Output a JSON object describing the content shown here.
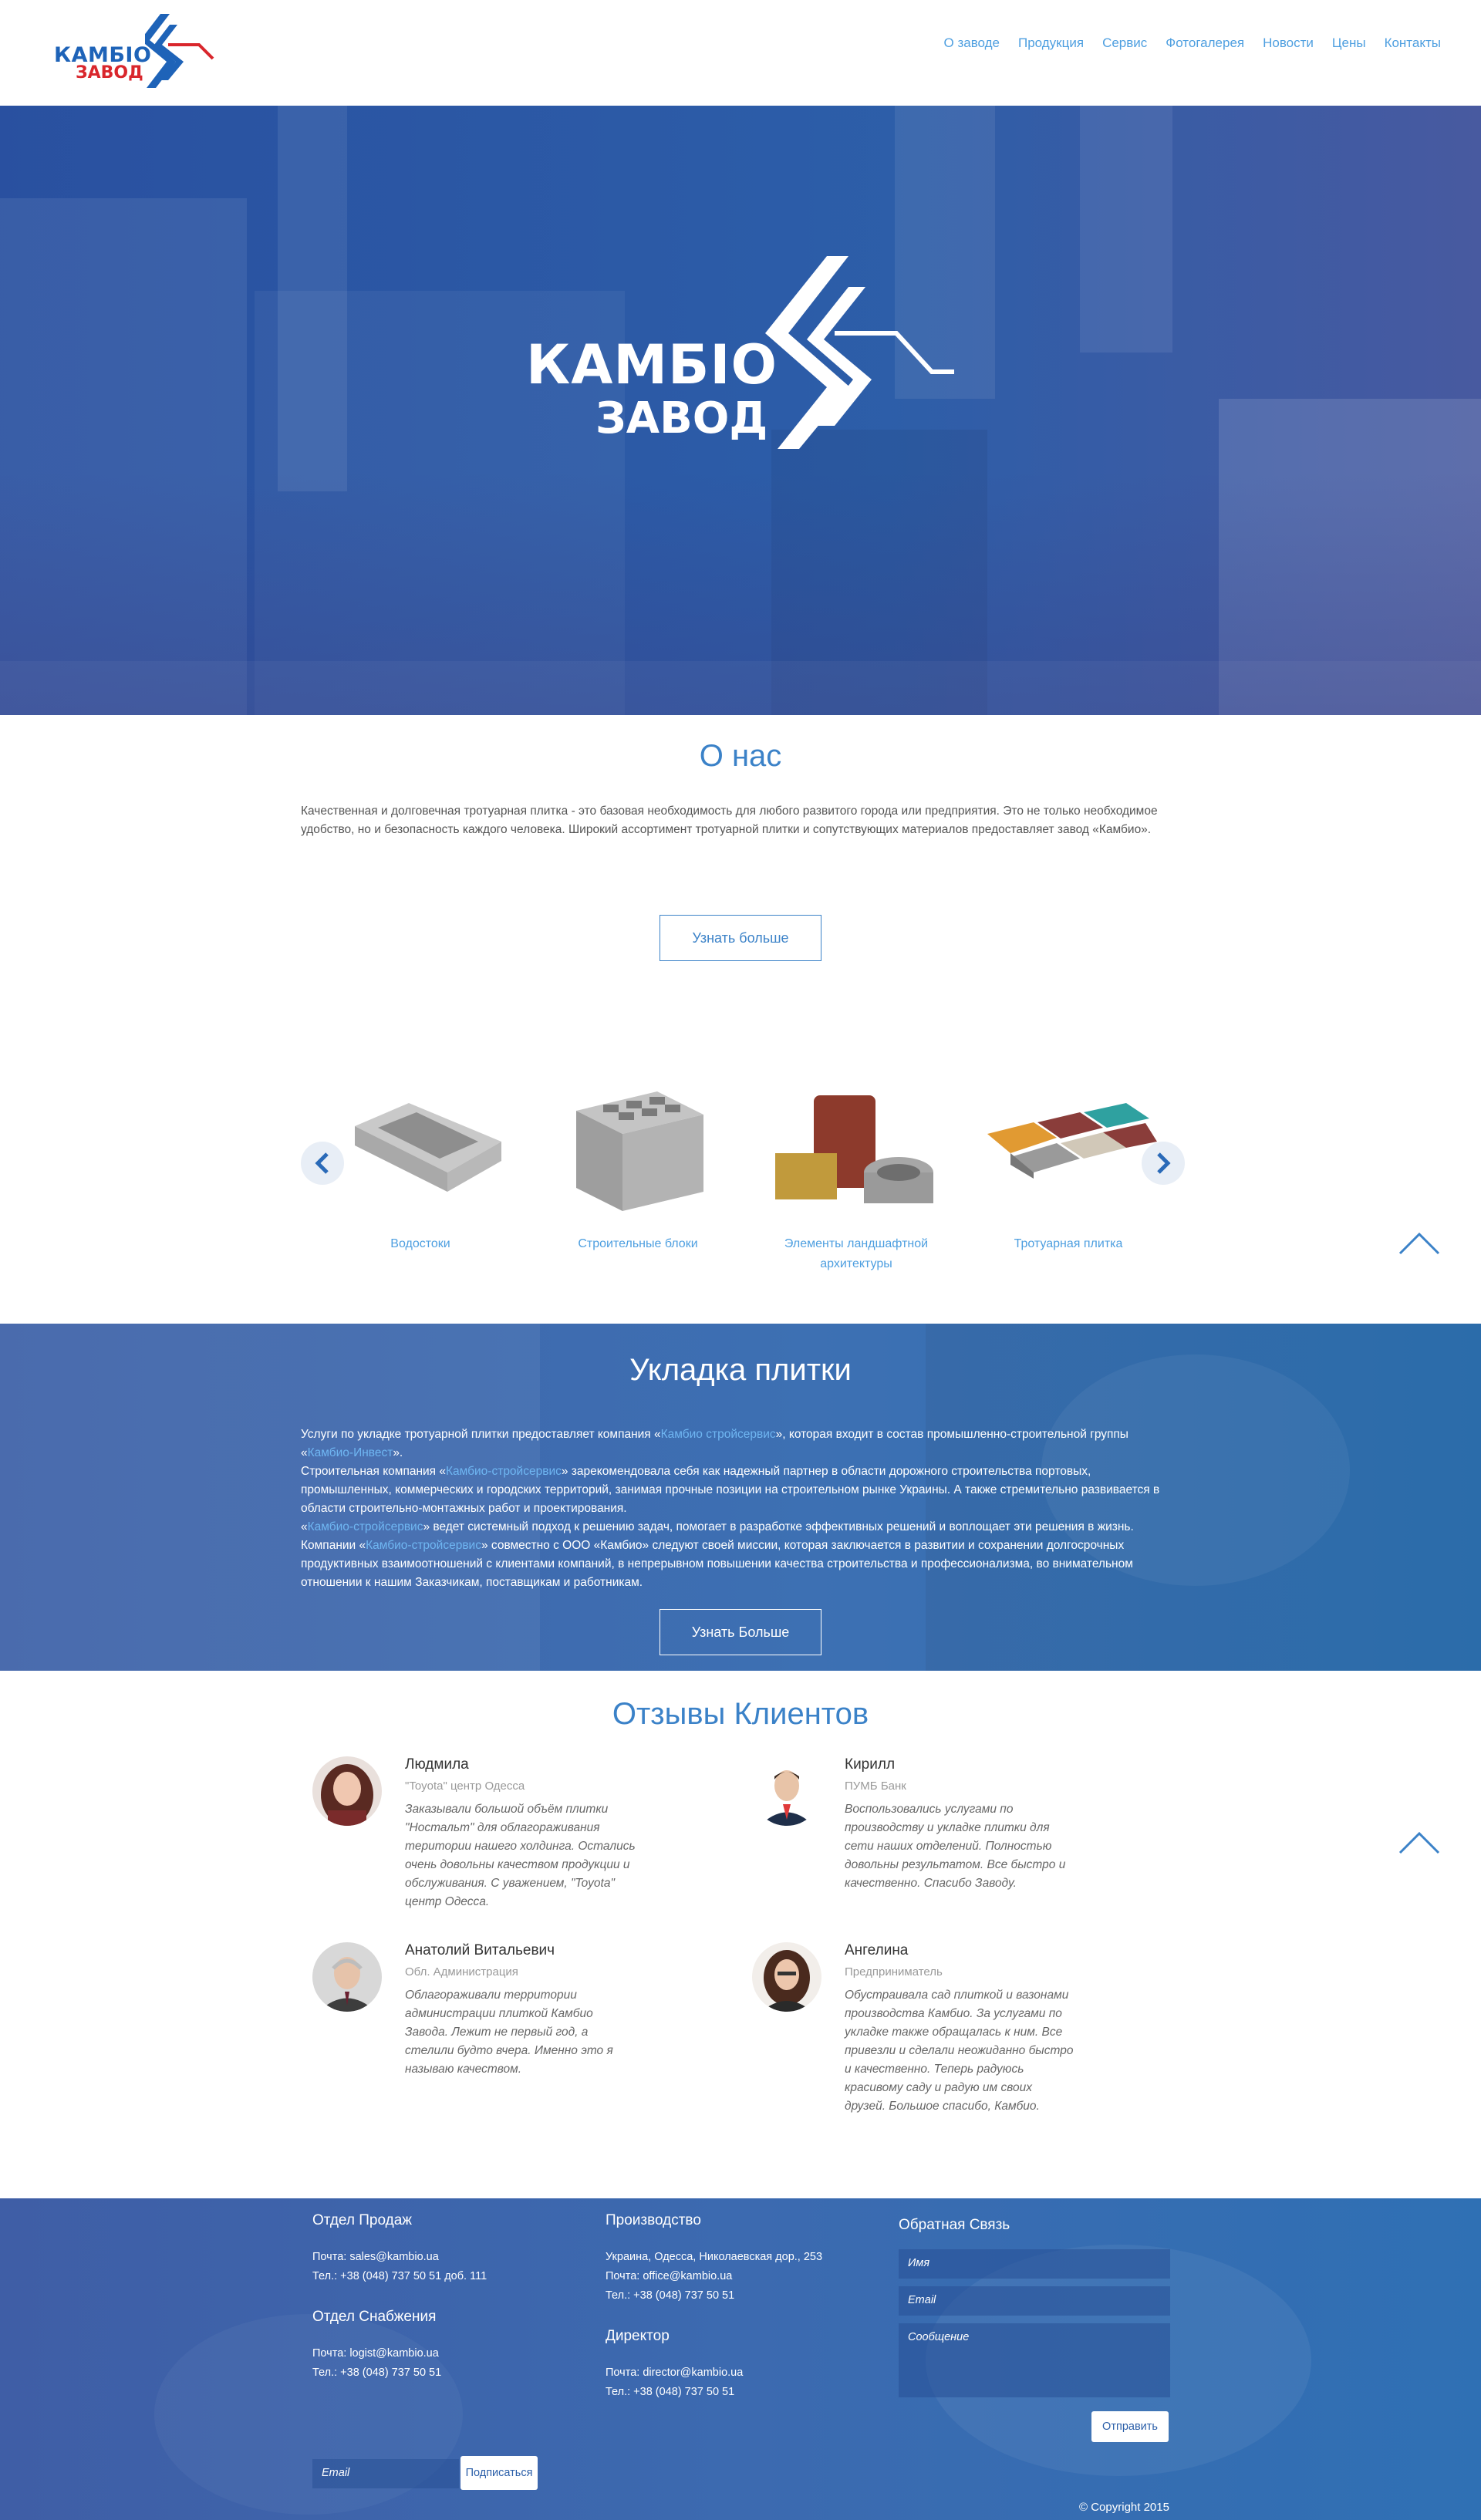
{
  "header": {
    "logo_line1": "КАМБІО",
    "logo_line2": "ЗАВОД",
    "nav": [
      "О заводе",
      "Продукция",
      "Сервис",
      "Фотогалерея",
      "Новости",
      "Цены",
      "Контакты"
    ]
  },
  "hero": {
    "logo_line1": "КАМБІО",
    "logo_line2": "ЗАВОД"
  },
  "about": {
    "title": "О нас",
    "text": "Качественная и долговечная тротуарная плитка - это базовая необходимость для любого развитого города или предприятия. Это не только необходимое удобство, но и безопасность каждого человека. Широкий ассортимент тротуарной плитки и сопутствующих материалов предоставляет завод «Камбио».",
    "button": "Узнать больше"
  },
  "products": {
    "items": [
      {
        "label": "Водостоки",
        "icon": "gutter-product-image"
      },
      {
        "label": "Строительные блоки",
        "icon": "block-product-image"
      },
      {
        "label": "Элементы ландшафтной архитектуры",
        "icon": "landscape-product-image"
      },
      {
        "label": "Тротуарная плитка",
        "icon": "paving-product-image"
      }
    ],
    "prev_icon": "chevron-left-icon",
    "next_icon": "chevron-right-icon"
  },
  "laying": {
    "title": "Укладка плитки",
    "p1_a": "Услуги по укладке тротуарной плитки предоставляет компания «",
    "p1_link": "Камбио стройсервис",
    "p1_b": "», которая входит в состав промышленно-строительной группы «",
    "p1_link2": "Камбио-Инвест",
    "p1_c": "».",
    "p2_a": "Строительная компания «",
    "p2_link": "Камбио-стройсервис",
    "p2_b": "» зарекомендовала себя как надежный партнер в области дорожного строительства портовых, промышленных, коммерческих и городских территорий, занимая прочные позиции на строительном рынке Украины. А также стремительно развивается в области строительно-монтажных работ и проектирования.",
    "p3_a": "«",
    "p3_link": "Камбио-стройсервис",
    "p3_b": "» ведет системный подход к решению задач, помогает в разработке эффективных решений и воплощает эти решения в жизнь.",
    "p4_a": "Компании «",
    "p4_link": "Камбио-стройсервис",
    "p4_b": "» совместно с ООО «Камбио» следуют своей миссии, которая заключается в развитии и сохранении долгосрочных продуктивных взаимоотношений с клиентами компаний, в непрерывном повышении качества строительства и профессионализма, во внимательном отношении к нашим Заказчикам, поставщикам и работникам.",
    "button": "Узнать Больше"
  },
  "reviews": {
    "title": "Отзывы Клиентов",
    "items": [
      {
        "name": "Людмила",
        "org": "\"Toyota\" центр Одесса",
        "text": "Заказывали большой объём плитки \"Ностальт\" для облагораживания територии нашего холдинга. Остались очень довольны качеством продукции и обслуживания. С уважением, \"Toyota\" центр Одесса."
      },
      {
        "name": "Кирилл",
        "org": "ПУМБ Банк",
        "text": "Воспользовались услугами по производству и укладке плитки для сети наших отделений. Полностью довольны результатом. Все быстро и качественно. Спасибо Заводу."
      },
      {
        "name": "Анатолий Витальевич",
        "org": "Обл. Администрация",
        "text": "Облагораживали территории администрации плиткой Камбио Завода. Лежит не первый год, а стелили будто вчера. Именно это я называю качеством."
      },
      {
        "name": "Ангелина",
        "org": "Предприниматель",
        "text": "Обустраивала сад плиткой и вазонами производства Камбио. За услугами по укладке также обращалась к ним. Все привезли и сделали неожиданно быстро и качественно. Теперь радуюсь красивому саду и радую им своих друзей. Большое спасибо, Камбио."
      }
    ]
  },
  "footer": {
    "sales_title": "Отдел Продаж",
    "sales_mail": "Почта: sales@kambio.ua",
    "sales_tel": "Тел.: +38 (048) 737 50 51 доб. 111",
    "supply_title": "Отдел Снабжения",
    "supply_mail": "Почта: logist@kambio.ua",
    "supply_tel": "Тел.: +38 (048) 737 50 51",
    "prod_title": "Производство",
    "prod_addr": "Украина, Одесса, Николаевская дор., 253",
    "prod_mail": "Почта: office@kambio.ua",
    "prod_tel": "Тел.: +38 (048) 737 50 51",
    "dir_title": "Директор",
    "dir_mail": "Почта: director@kambio.ua",
    "dir_tel": "Тел.: +38 (048) 737 50 51",
    "feedback_title": "Обратная Связь",
    "name_placeholder": "Имя",
    "email_placeholder": "Email",
    "message_placeholder": "Сообщение",
    "send_button": "Отправить",
    "subscribe_placeholder": "Email",
    "subscribe_button": "Подписаться",
    "copyright": "© Copyright 2015"
  },
  "colors": {
    "accent": "#3b82c8",
    "link": "#4e9fe0",
    "brand_red": "#d9262c",
    "hero_blue": "#2b55a0"
  }
}
